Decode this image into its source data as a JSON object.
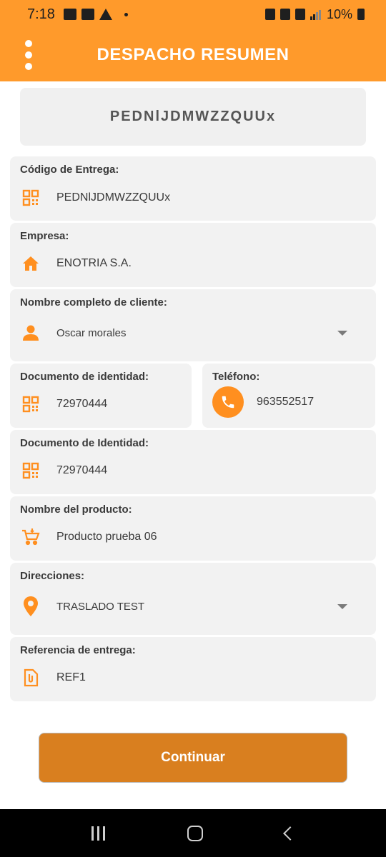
{
  "status_bar": {
    "time": "7:18",
    "battery": "10%"
  },
  "app_bar": {
    "title": "DESPACHO RESUMEN",
    "menu_icon": "more-vert-icon"
  },
  "code_banner": "PEDNlJDMWZZQUUx",
  "fields": {
    "codigo": {
      "label": "Código de Entrega:",
      "value": "PEDNlJDMWZZQUUx",
      "icon": "qr-code-icon"
    },
    "empresa": {
      "label": "Empresa:",
      "value": "ENOTRIA S.A.",
      "icon": "home-icon"
    },
    "cliente": {
      "label": "Nombre completo de cliente:",
      "value": "Oscar morales",
      "icon": "person-icon"
    },
    "documento": {
      "label": "Documento de identidad:",
      "value": "72970444",
      "icon": "qr-code-icon"
    },
    "telefono": {
      "label": "Teléfono:",
      "value": "963552517",
      "icon": "phone-icon"
    },
    "documento2": {
      "label": "Documento de Identidad:",
      "value": "72970444",
      "icon": "qr-code-icon"
    },
    "producto": {
      "label": "Nombre del producto:",
      "value": "Producto prueba 06",
      "icon": "cart-icon"
    },
    "direcciones": {
      "label": "Direcciones:",
      "value": "TRASLADO TEST",
      "icon": "location-pin-icon"
    },
    "referencia": {
      "label": "Referencia de entrega:",
      "value": "REF1",
      "icon": "attachment-file-icon"
    }
  },
  "continue_label": "Continuar",
  "colors": {
    "primary": "#ff9a2b",
    "button": "#d97f1f",
    "card": "#f2f2f2",
    "icon": "#ff8f1f"
  }
}
